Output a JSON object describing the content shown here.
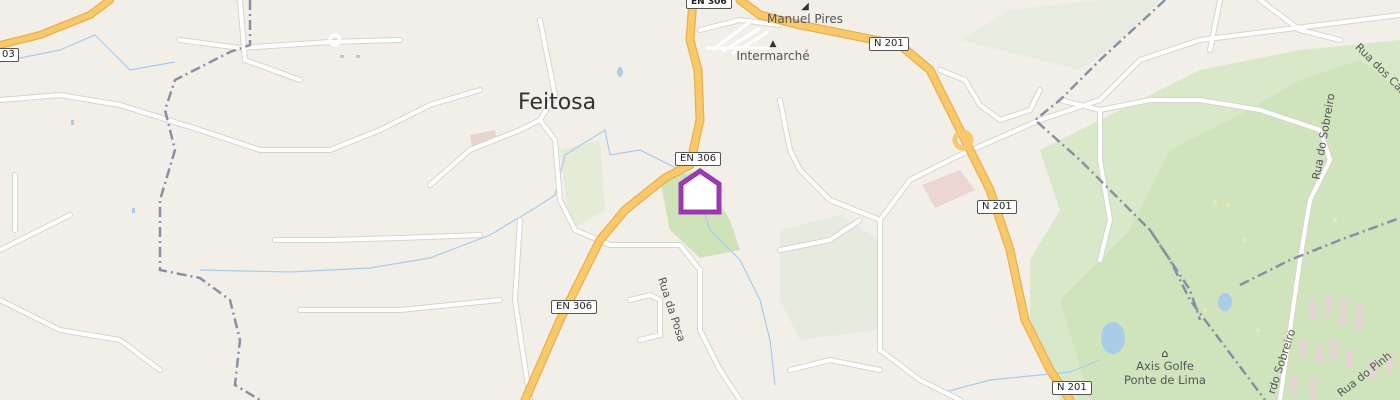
{
  "map": {
    "place_label": "Feitosa",
    "road_shields": [
      {
        "id": "en306-top",
        "text": "EN 306"
      },
      {
        "id": "en306-mid",
        "text": "EN 306"
      },
      {
        "id": "en306-low",
        "text": "EN 306"
      },
      {
        "id": "n201-top",
        "text": "N 201"
      },
      {
        "id": "n201-mid",
        "text": "N 201"
      },
      {
        "id": "n201-low",
        "text": "N 201"
      },
      {
        "id": "left-edge",
        "text": "03"
      }
    ],
    "street_labels": {
      "rua_da_posa": "Rua da Posa",
      "rua_do_sobreiro": "Rua do Sobreiro",
      "rua_dos_castro": "Rua dos Castro",
      "rua_do_sobreiro_2": "rdo Sobreiro",
      "rua_do_pinh": "Rua do Pinh"
    },
    "pois": {
      "manuel_pires": "Manuel Pires",
      "intermarche": "Intermarché",
      "golf_line1": "Axis Golfe",
      "golf_line2": "Ponte de Lima"
    },
    "icons": {
      "marker": "home-marker-icon",
      "shop": "shopping-basket-icon",
      "supermarket": "shopping-cart-icon",
      "golf": "golf-icon"
    },
    "colors": {
      "background": "#f2efe9",
      "primary_road": "#f7c96b",
      "primary_road_casing": "#e8b04e",
      "minor_road": "#ffffff",
      "water": "#a9cde8",
      "park": "#d7e7c8",
      "boundary": "#8a8fa3",
      "marker": "#9a3ab0",
      "label": "#333333"
    }
  }
}
